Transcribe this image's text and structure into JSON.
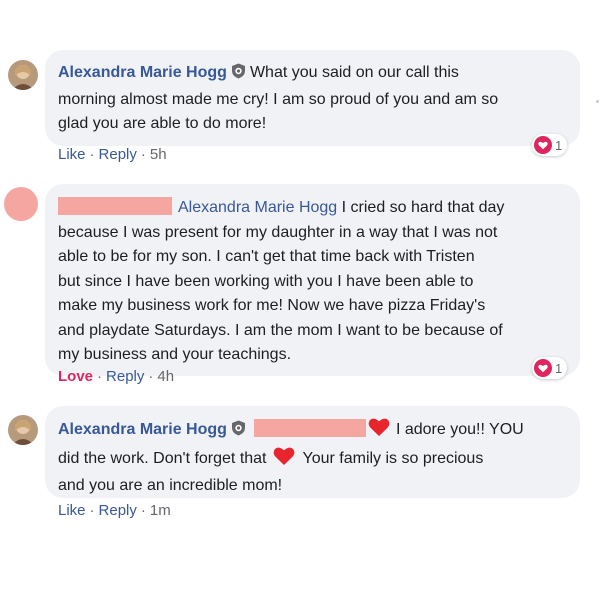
{
  "comments": [
    {
      "author": "Alexandra Marie Hogg",
      "lines": [
        "What you said on our call this",
        "morning almost made me cry! I am so proud of you and am so",
        "glad you are able to do more!"
      ],
      "actions": {
        "like": "Like",
        "reply": "Reply",
        "time": "5h"
      },
      "reaction_count": "1"
    },
    {
      "mention": "Alexandra Marie Hogg",
      "lines": [
        "I cried so hard that day",
        "because I was present for my daughter in a way that I was not",
        "able to be for my son. I can't get that time back with Tristen",
        "but since I have been working with you I have been able to",
        "make my business work for me! Now we have pizza Friday's",
        "and playdate Saturdays. I am the mom I want to be because of",
        "my business and your teachings."
      ],
      "actions": {
        "like": "Love",
        "reply": "Reply",
        "time": "4h"
      },
      "reaction_count": "1"
    },
    {
      "author": "Alexandra Marie Hogg",
      "lines": [
        "I adore you!! YOU",
        "did the work. Don't forget that",
        "Your family is so precious",
        "and you are an incredible mom!"
      ],
      "actions": {
        "like": "Like",
        "reply": "Reply",
        "time": "1m"
      }
    }
  ],
  "colors": {
    "name_blue": "#385898",
    "bubble_bg": "#f0f2f5",
    "love_red": "#e0245e",
    "redaction": "#f6a6a0",
    "meta_gray": "#65676b"
  },
  "icons": [
    "verified-shield-icon",
    "heart-icon",
    "love-reaction-icon"
  ]
}
